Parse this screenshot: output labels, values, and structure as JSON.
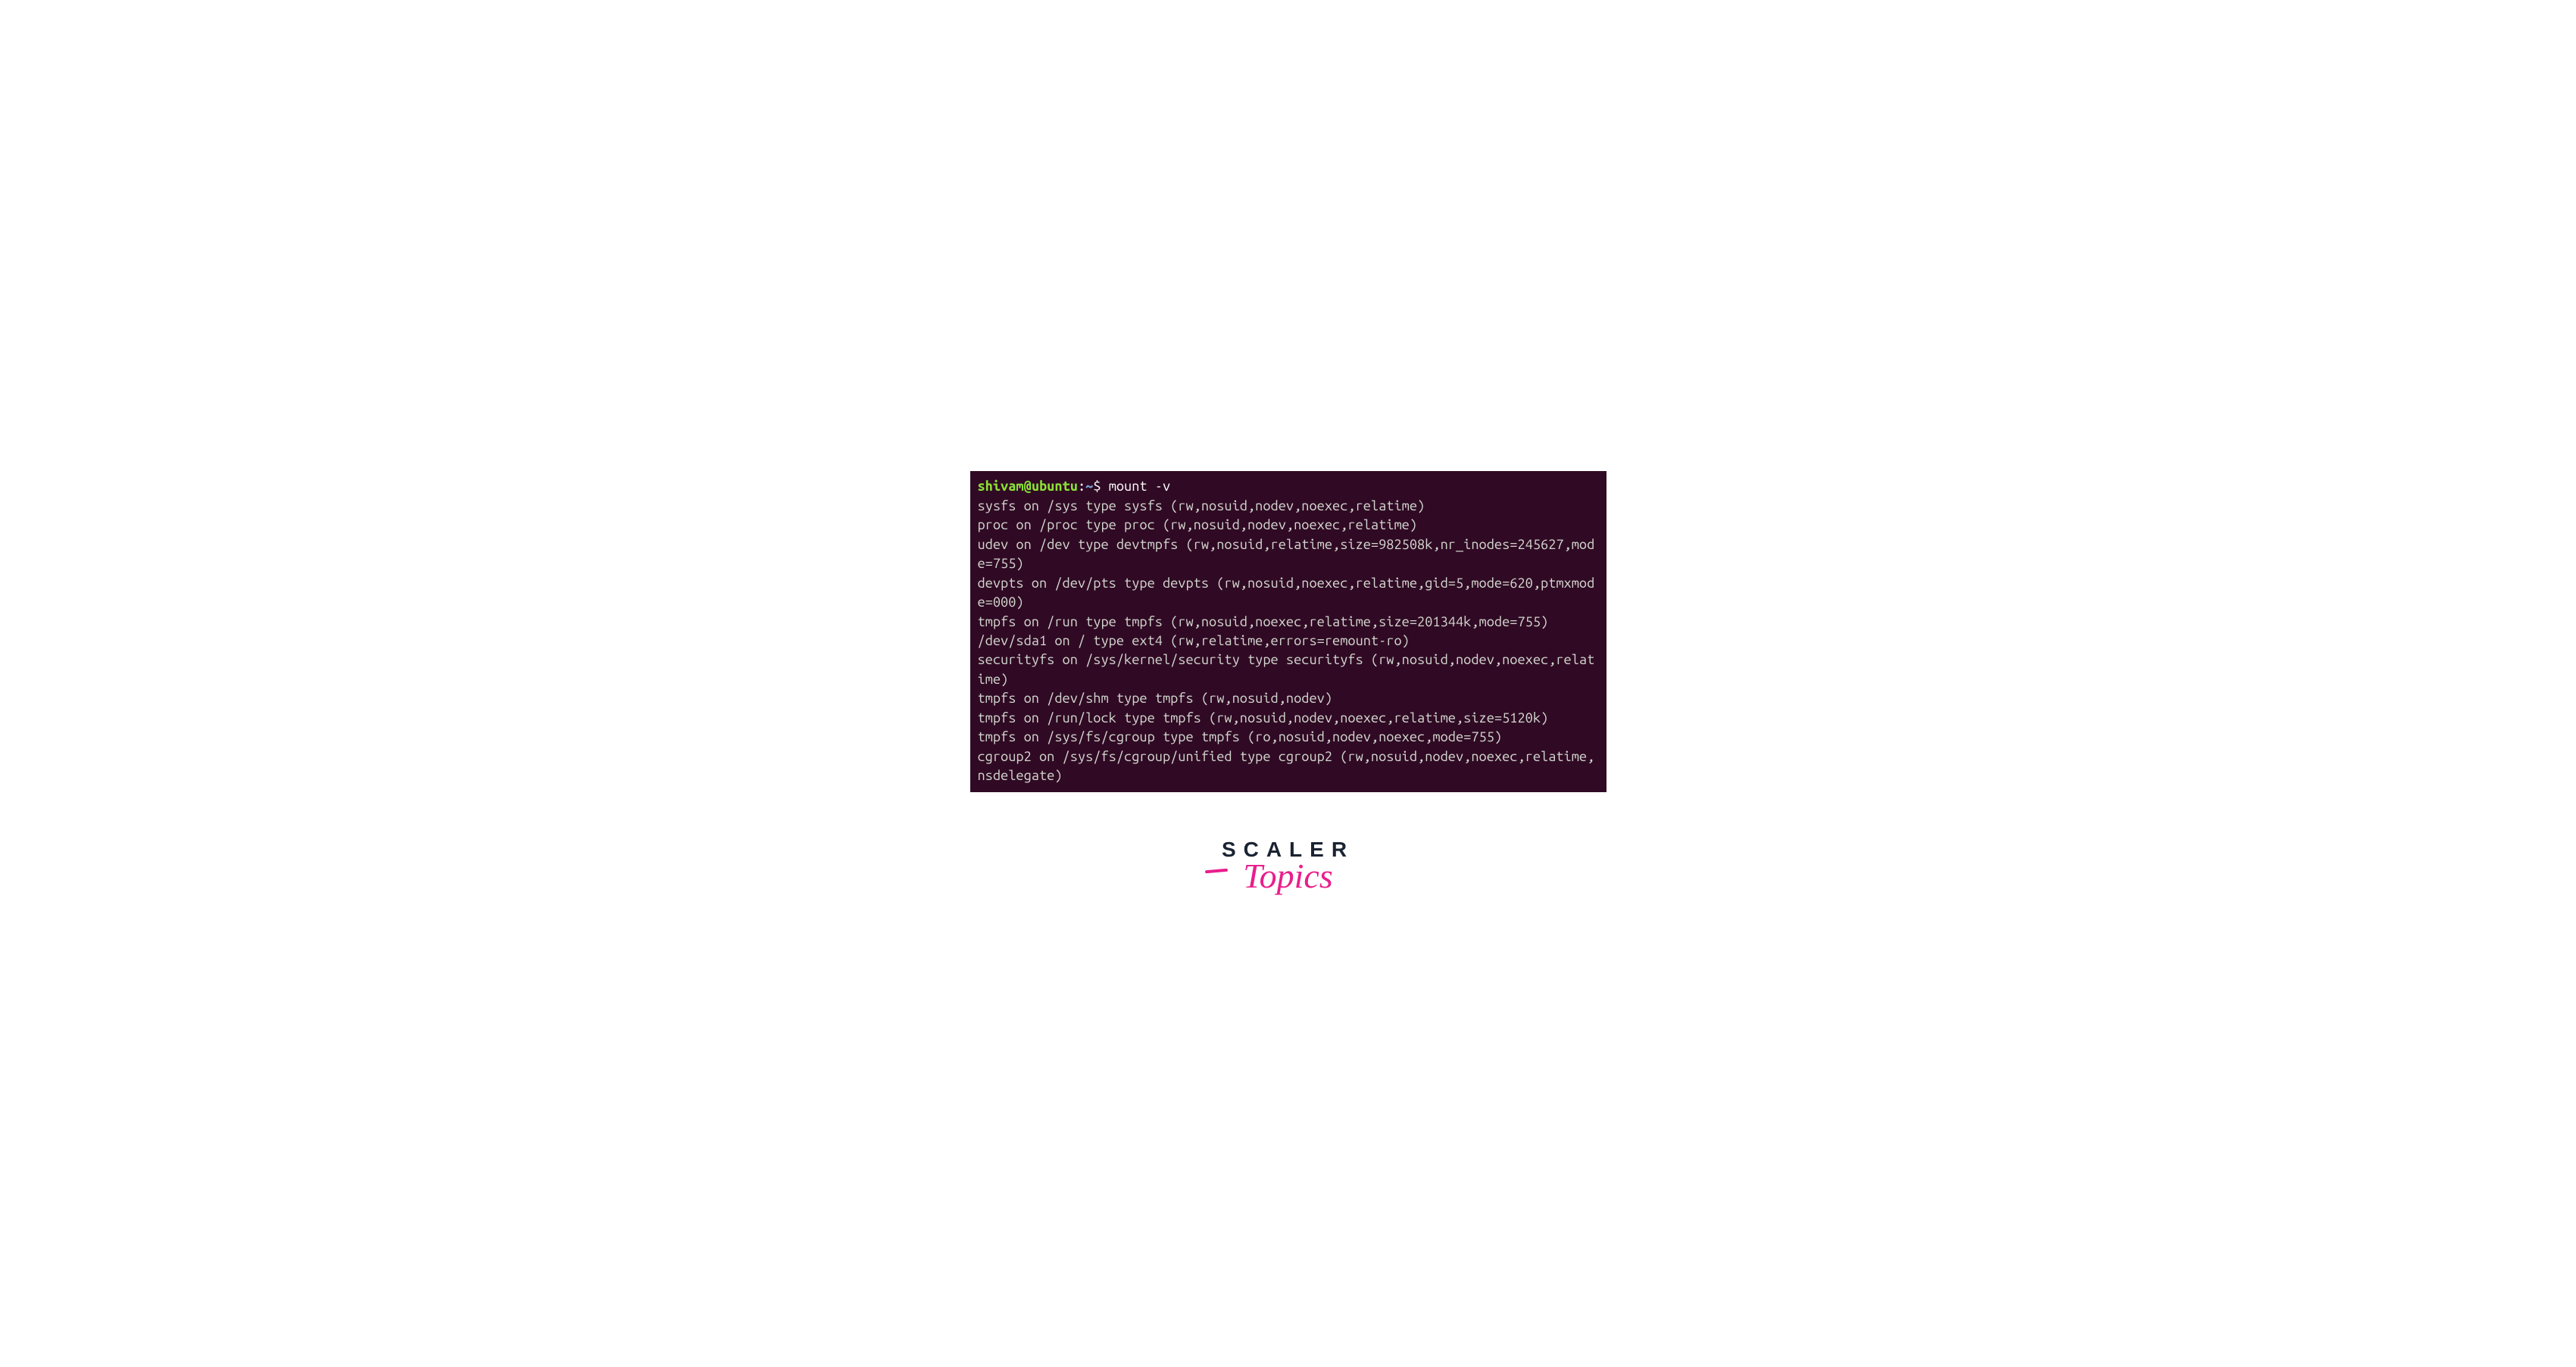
{
  "prompt": {
    "user": "shivam",
    "at": "@",
    "host": "ubuntu",
    "colon": ":",
    "path": "~",
    "dollar": "$ "
  },
  "command": "mount -v",
  "output": [
    "sysfs on /sys type sysfs (rw,nosuid,nodev,noexec,relatime)",
    "proc on /proc type proc (rw,nosuid,nodev,noexec,relatime)",
    "udev on /dev type devtmpfs (rw,nosuid,relatime,size=982508k,nr_inodes=245627,mode=755)",
    "devpts on /dev/pts type devpts (rw,nosuid,noexec,relatime,gid=5,mode=620,ptmxmode=000)",
    "tmpfs on /run type tmpfs (rw,nosuid,noexec,relatime,size=201344k,mode=755)",
    "/dev/sda1 on / type ext4 (rw,relatime,errors=remount-ro)",
    "securityfs on /sys/kernel/security type securityfs (rw,nosuid,nodev,noexec,relatime)",
    "tmpfs on /dev/shm type tmpfs (rw,nosuid,nodev)",
    "tmpfs on /run/lock type tmpfs (rw,nosuid,nodev,noexec,relatime,size=5120k)",
    "tmpfs on /sys/fs/cgroup type tmpfs (ro,nosuid,nodev,noexec,mode=755)",
    "cgroup2 on /sys/fs/cgroup/unified type cgroup2 (rw,nosuid,nodev,noexec,relatime,nsdelegate)"
  ],
  "logo": {
    "scaler": "SCALER",
    "topics": "Topics"
  }
}
